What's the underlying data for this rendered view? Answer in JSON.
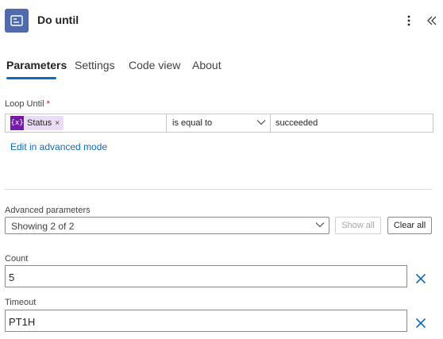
{
  "header": {
    "title": "Do until",
    "icon": "loop-icon",
    "more_icon": "more-vertical-icon",
    "collapse_icon": "double-chevron-left-icon",
    "accent": "#4f6bab"
  },
  "tabs": [
    {
      "label": "Parameters",
      "active": true
    },
    {
      "label": "Settings",
      "active": false
    },
    {
      "label": "Code view",
      "active": false
    },
    {
      "label": "About",
      "active": false
    }
  ],
  "loop_until": {
    "label": "Loop Until",
    "required_mark": "*",
    "token": {
      "icon": "variable-icon",
      "icon_text": "{x}",
      "label": "Status",
      "remove_glyph": "×"
    },
    "operator": "is equal to",
    "value": "succeeded",
    "advanced_link": "Edit in advanced mode"
  },
  "advanced": {
    "label": "Advanced parameters",
    "selected": "Showing 2 of 2",
    "show_all": "Show all",
    "clear_all": "Clear all"
  },
  "count": {
    "label": "Count",
    "value": "5"
  },
  "timeout": {
    "label": "Timeout",
    "value": "PT1H"
  },
  "colors": {
    "link": "#0f6cbd",
    "token_bg": "#eadcf5",
    "token_icon": "#7719aa",
    "required": "#c50f1f"
  }
}
